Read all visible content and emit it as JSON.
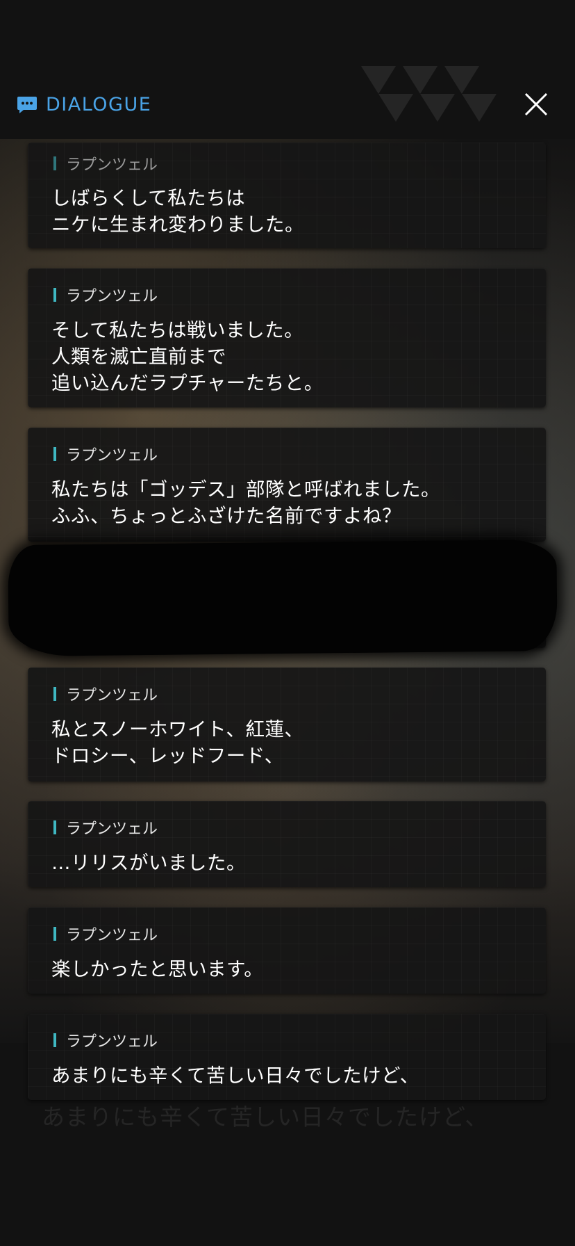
{
  "header": {
    "title": "DIALOGUE",
    "icon": "chat-bubble-icon",
    "close_icon": "close-icon",
    "accent_color": "#4aa3e6"
  },
  "speaker_accent_color": "#3fb8c2",
  "dialogue": [
    {
      "speaker": "ラプンツェル",
      "lines": [
        "しばらくして私たちは",
        "ニケに生まれ変わりました。"
      ]
    },
    {
      "speaker": "ラプンツェル",
      "lines": [
        "そして私たちは戦いました。",
        "人類を滅亡直前まで",
        "追い込んだラプチャーたちと。"
      ]
    },
    {
      "speaker": "ラプンツェル",
      "lines": [
        "私たちは「ゴッデス」部隊と呼ばれました。",
        "ふふ、ちょっとふざけた名前ですよね？"
      ]
    },
    {
      "speaker": "ラプンツェル",
      "lines": [
        "私とスノーホワイト、紅蓮、",
        "ドロシー、レッドフード、"
      ]
    },
    {
      "speaker": "ラプンツェル",
      "lines": [
        "…リリスがいました。"
      ]
    },
    {
      "speaker": "ラプンツェル",
      "lines": [
        "楽しかったと思います。"
      ]
    },
    {
      "speaker": "ラプンツェル",
      "lines": [
        "あまりにも辛くて苦しい日々でしたけど、"
      ]
    }
  ],
  "background_caption": "あまりにも辛くて苦しい日々でしたけど、"
}
